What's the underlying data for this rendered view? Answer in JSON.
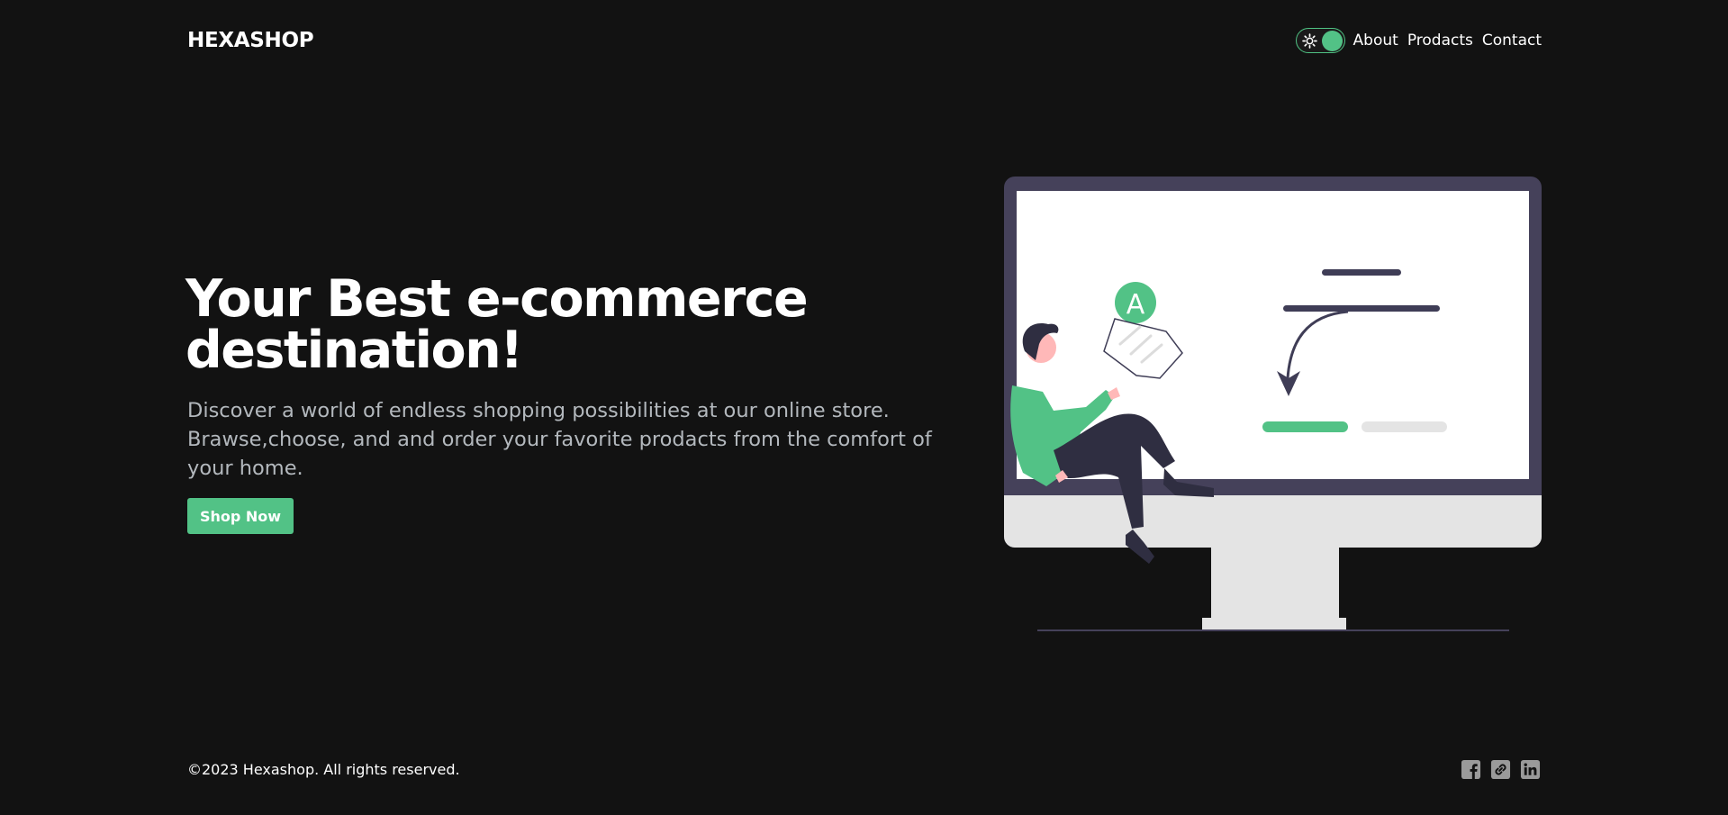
{
  "header": {
    "logo": "HEXASHOP",
    "nav": [
      {
        "label": "About"
      },
      {
        "label": "Prodacts"
      },
      {
        "label": "Contact"
      }
    ],
    "theme_toggle": {
      "icon": "sun-icon",
      "state": "on"
    }
  },
  "hero": {
    "title": "Your Best e-commerce destination!",
    "subtitle": "Discover a world of endless shopping possibilities at our online store. Brawse,choose, and and order your favorite prodacts from the comfort of your home.",
    "cta_label": "Shop Now",
    "illustration_badge": "A"
  },
  "footer": {
    "copyright": "©2023 Hexashop. All rights reserved.",
    "socials": [
      {
        "icon": "facebook-icon"
      },
      {
        "icon": "link-icon"
      },
      {
        "icon": "linkedin-icon"
      }
    ]
  },
  "colors": {
    "background": "#121212",
    "accent": "#52c286",
    "text": "#ffffff",
    "muted_text": "#b3b8bd",
    "monitor_frame": "#45415a",
    "monitor_stand": "#e4e4e4"
  }
}
